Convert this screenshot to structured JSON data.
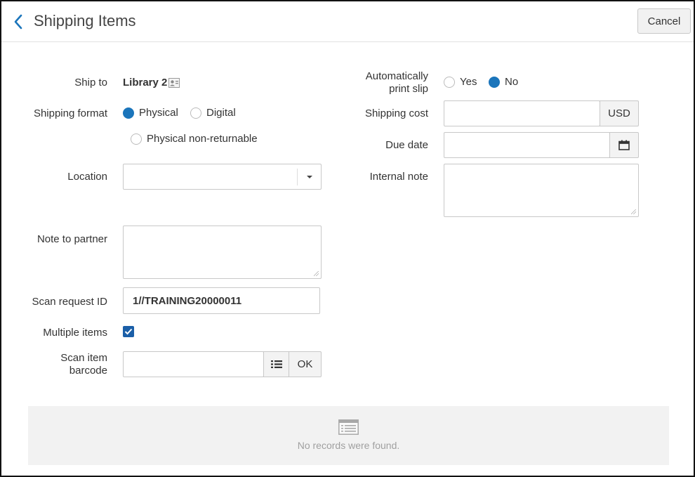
{
  "header": {
    "title": "Shipping Items",
    "cancel_label": "Cancel"
  },
  "form": {
    "ship_to": {
      "label": "Ship to",
      "value": "Library 2"
    },
    "shipping_format": {
      "label": "Shipping format",
      "options": [
        "Physical",
        "Digital",
        "Physical non-returnable"
      ],
      "selected": "Physical"
    },
    "location": {
      "label": "Location",
      "value": ""
    },
    "note_to_partner": {
      "label": "Note to partner",
      "value": ""
    },
    "scan_request_id": {
      "label": "Scan request ID",
      "value": "1//TRAINING20000011"
    },
    "multiple_items": {
      "label": "Multiple items",
      "checked": true
    },
    "scan_item_barcode": {
      "label_line1": "Scan item",
      "label_line2": "barcode",
      "value": "",
      "ok_label": "OK"
    },
    "auto_print_slip": {
      "label_line1": "Automatically",
      "label_line2": "print slip",
      "options": [
        "Yes",
        "No"
      ],
      "selected": "No"
    },
    "shipping_cost": {
      "label": "Shipping cost",
      "value": "",
      "currency": "USD"
    },
    "due_date": {
      "label": "Due date",
      "value": ""
    },
    "internal_note": {
      "label": "Internal note",
      "value": ""
    }
  },
  "results": {
    "empty_message": "No records were found."
  },
  "colors": {
    "accent": "#1b75bb",
    "checkbox": "#1b5fa8"
  }
}
